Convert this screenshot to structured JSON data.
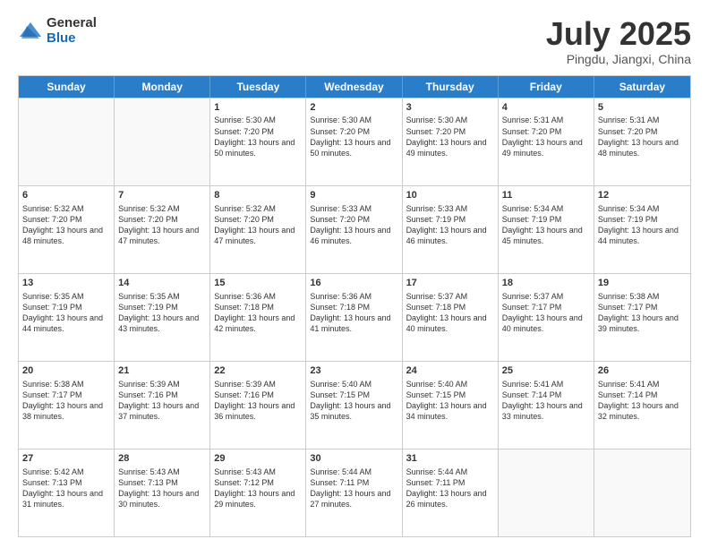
{
  "logo": {
    "general": "General",
    "blue": "Blue"
  },
  "header": {
    "month": "July 2025",
    "location": "Pingdu, Jiangxi, China"
  },
  "weekdays": [
    "Sunday",
    "Monday",
    "Tuesday",
    "Wednesday",
    "Thursday",
    "Friday",
    "Saturday"
  ],
  "weeks": [
    [
      {
        "day": "",
        "sunrise": "",
        "sunset": "",
        "daylight": "",
        "empty": true
      },
      {
        "day": "",
        "sunrise": "",
        "sunset": "",
        "daylight": "",
        "empty": true
      },
      {
        "day": "1",
        "sunrise": "Sunrise: 5:30 AM",
        "sunset": "Sunset: 7:20 PM",
        "daylight": "Daylight: 13 hours and 50 minutes.",
        "empty": false
      },
      {
        "day": "2",
        "sunrise": "Sunrise: 5:30 AM",
        "sunset": "Sunset: 7:20 PM",
        "daylight": "Daylight: 13 hours and 50 minutes.",
        "empty": false
      },
      {
        "day": "3",
        "sunrise": "Sunrise: 5:30 AM",
        "sunset": "Sunset: 7:20 PM",
        "daylight": "Daylight: 13 hours and 49 minutes.",
        "empty": false
      },
      {
        "day": "4",
        "sunrise": "Sunrise: 5:31 AM",
        "sunset": "Sunset: 7:20 PM",
        "daylight": "Daylight: 13 hours and 49 minutes.",
        "empty": false
      },
      {
        "day": "5",
        "sunrise": "Sunrise: 5:31 AM",
        "sunset": "Sunset: 7:20 PM",
        "daylight": "Daylight: 13 hours and 48 minutes.",
        "empty": false
      }
    ],
    [
      {
        "day": "6",
        "sunrise": "Sunrise: 5:32 AM",
        "sunset": "Sunset: 7:20 PM",
        "daylight": "Daylight: 13 hours and 48 minutes.",
        "empty": false
      },
      {
        "day": "7",
        "sunrise": "Sunrise: 5:32 AM",
        "sunset": "Sunset: 7:20 PM",
        "daylight": "Daylight: 13 hours and 47 minutes.",
        "empty": false
      },
      {
        "day": "8",
        "sunrise": "Sunrise: 5:32 AM",
        "sunset": "Sunset: 7:20 PM",
        "daylight": "Daylight: 13 hours and 47 minutes.",
        "empty": false
      },
      {
        "day": "9",
        "sunrise": "Sunrise: 5:33 AM",
        "sunset": "Sunset: 7:20 PM",
        "daylight": "Daylight: 13 hours and 46 minutes.",
        "empty": false
      },
      {
        "day": "10",
        "sunrise": "Sunrise: 5:33 AM",
        "sunset": "Sunset: 7:19 PM",
        "daylight": "Daylight: 13 hours and 46 minutes.",
        "empty": false
      },
      {
        "day": "11",
        "sunrise": "Sunrise: 5:34 AM",
        "sunset": "Sunset: 7:19 PM",
        "daylight": "Daylight: 13 hours and 45 minutes.",
        "empty": false
      },
      {
        "day": "12",
        "sunrise": "Sunrise: 5:34 AM",
        "sunset": "Sunset: 7:19 PM",
        "daylight": "Daylight: 13 hours and 44 minutes.",
        "empty": false
      }
    ],
    [
      {
        "day": "13",
        "sunrise": "Sunrise: 5:35 AM",
        "sunset": "Sunset: 7:19 PM",
        "daylight": "Daylight: 13 hours and 44 minutes.",
        "empty": false
      },
      {
        "day": "14",
        "sunrise": "Sunrise: 5:35 AM",
        "sunset": "Sunset: 7:19 PM",
        "daylight": "Daylight: 13 hours and 43 minutes.",
        "empty": false
      },
      {
        "day": "15",
        "sunrise": "Sunrise: 5:36 AM",
        "sunset": "Sunset: 7:18 PM",
        "daylight": "Daylight: 13 hours and 42 minutes.",
        "empty": false
      },
      {
        "day": "16",
        "sunrise": "Sunrise: 5:36 AM",
        "sunset": "Sunset: 7:18 PM",
        "daylight": "Daylight: 13 hours and 41 minutes.",
        "empty": false
      },
      {
        "day": "17",
        "sunrise": "Sunrise: 5:37 AM",
        "sunset": "Sunset: 7:18 PM",
        "daylight": "Daylight: 13 hours and 40 minutes.",
        "empty": false
      },
      {
        "day": "18",
        "sunrise": "Sunrise: 5:37 AM",
        "sunset": "Sunset: 7:17 PM",
        "daylight": "Daylight: 13 hours and 40 minutes.",
        "empty": false
      },
      {
        "day": "19",
        "sunrise": "Sunrise: 5:38 AM",
        "sunset": "Sunset: 7:17 PM",
        "daylight": "Daylight: 13 hours and 39 minutes.",
        "empty": false
      }
    ],
    [
      {
        "day": "20",
        "sunrise": "Sunrise: 5:38 AM",
        "sunset": "Sunset: 7:17 PM",
        "daylight": "Daylight: 13 hours and 38 minutes.",
        "empty": false
      },
      {
        "day": "21",
        "sunrise": "Sunrise: 5:39 AM",
        "sunset": "Sunset: 7:16 PM",
        "daylight": "Daylight: 13 hours and 37 minutes.",
        "empty": false
      },
      {
        "day": "22",
        "sunrise": "Sunrise: 5:39 AM",
        "sunset": "Sunset: 7:16 PM",
        "daylight": "Daylight: 13 hours and 36 minutes.",
        "empty": false
      },
      {
        "day": "23",
        "sunrise": "Sunrise: 5:40 AM",
        "sunset": "Sunset: 7:15 PM",
        "daylight": "Daylight: 13 hours and 35 minutes.",
        "empty": false
      },
      {
        "day": "24",
        "sunrise": "Sunrise: 5:40 AM",
        "sunset": "Sunset: 7:15 PM",
        "daylight": "Daylight: 13 hours and 34 minutes.",
        "empty": false
      },
      {
        "day": "25",
        "sunrise": "Sunrise: 5:41 AM",
        "sunset": "Sunset: 7:14 PM",
        "daylight": "Daylight: 13 hours and 33 minutes.",
        "empty": false
      },
      {
        "day": "26",
        "sunrise": "Sunrise: 5:41 AM",
        "sunset": "Sunset: 7:14 PM",
        "daylight": "Daylight: 13 hours and 32 minutes.",
        "empty": false
      }
    ],
    [
      {
        "day": "27",
        "sunrise": "Sunrise: 5:42 AM",
        "sunset": "Sunset: 7:13 PM",
        "daylight": "Daylight: 13 hours and 31 minutes.",
        "empty": false
      },
      {
        "day": "28",
        "sunrise": "Sunrise: 5:43 AM",
        "sunset": "Sunset: 7:13 PM",
        "daylight": "Daylight: 13 hours and 30 minutes.",
        "empty": false
      },
      {
        "day": "29",
        "sunrise": "Sunrise: 5:43 AM",
        "sunset": "Sunset: 7:12 PM",
        "daylight": "Daylight: 13 hours and 29 minutes.",
        "empty": false
      },
      {
        "day": "30",
        "sunrise": "Sunrise: 5:44 AM",
        "sunset": "Sunset: 7:11 PM",
        "daylight": "Daylight: 13 hours and 27 minutes.",
        "empty": false
      },
      {
        "day": "31",
        "sunrise": "Sunrise: 5:44 AM",
        "sunset": "Sunset: 7:11 PM",
        "daylight": "Daylight: 13 hours and 26 minutes.",
        "empty": false
      },
      {
        "day": "",
        "sunrise": "",
        "sunset": "",
        "daylight": "",
        "empty": true
      },
      {
        "day": "",
        "sunrise": "",
        "sunset": "",
        "daylight": "",
        "empty": true
      }
    ]
  ]
}
